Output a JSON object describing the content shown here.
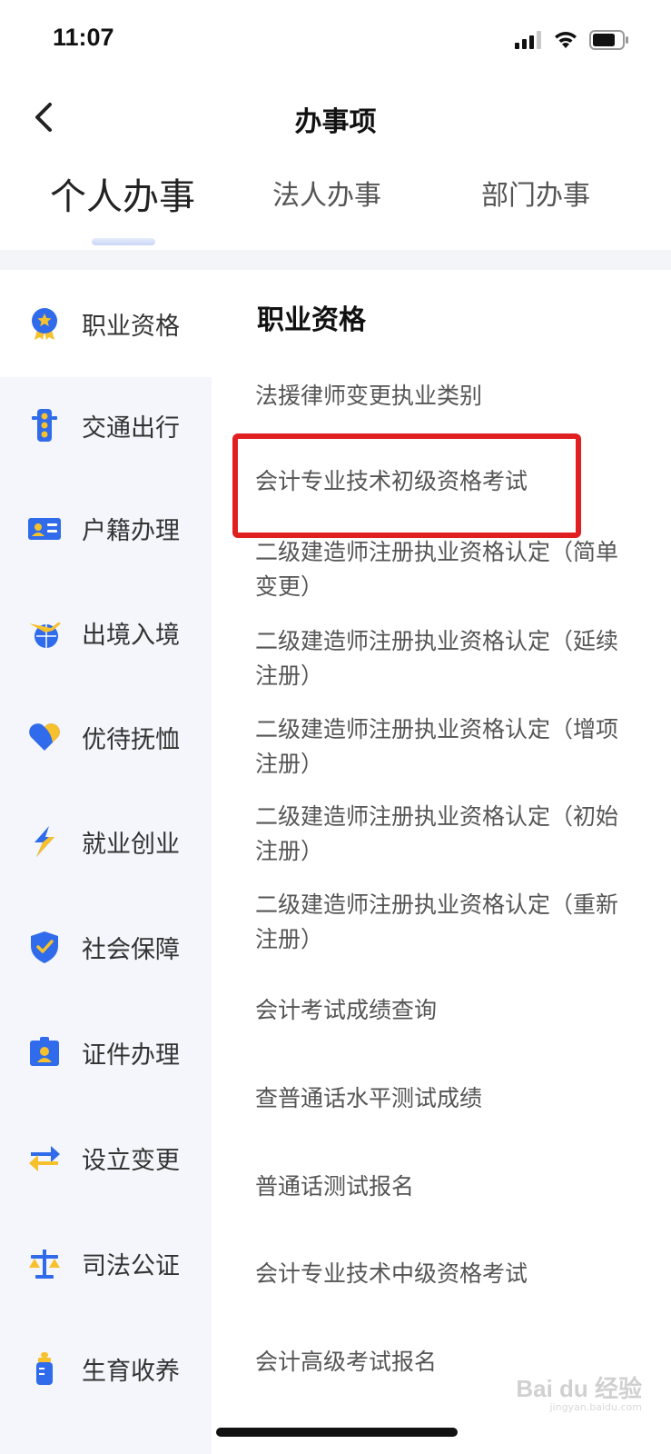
{
  "status_bar": {
    "time": "11:07",
    "icons": [
      "cellular-signal-icon",
      "wifi-icon",
      "battery-icon"
    ]
  },
  "nav": {
    "back_icon": "chevron-left-icon",
    "title": "办事项"
  },
  "tabs": [
    {
      "label": "个人办事",
      "active": true
    },
    {
      "label": "法人办事",
      "active": false
    },
    {
      "label": "部门办事",
      "active": false
    }
  ],
  "sidebar": {
    "items": [
      {
        "label": "职业资格",
        "icon": "medal-icon",
        "active": true
      },
      {
        "label": "交通出行",
        "icon": "traffic-light-icon",
        "active": false
      },
      {
        "label": "户籍办理",
        "icon": "id-card-icon",
        "active": false
      },
      {
        "label": "出境入境",
        "icon": "airplane-globe-icon",
        "active": false
      },
      {
        "label": "优待抚恤",
        "icon": "heart-icon",
        "active": false
      },
      {
        "label": "就业创业",
        "icon": "lightning-icon",
        "active": false
      },
      {
        "label": "社会保障",
        "icon": "shield-check-icon",
        "active": false
      },
      {
        "label": "证件办理",
        "icon": "certificate-icon",
        "active": false
      },
      {
        "label": "设立变更",
        "icon": "swap-arrows-icon",
        "active": false
      },
      {
        "label": "司法公证",
        "icon": "scales-icon",
        "active": false
      },
      {
        "label": "生育收养",
        "icon": "baby-bottle-icon",
        "active": false
      }
    ]
  },
  "content": {
    "section_title": "职业资格",
    "items": [
      "法援律师变更执业类别",
      "会计专业技术初级资格考试",
      "二级建造师注册执业资格认定（简单变更）",
      "二级建造师注册执业资格认定（延续注册）",
      "二级建造师注册执业资格认定（增项注册）",
      "二级建造师注册执业资格认定（初始注册）",
      "二级建造师注册执业资格认定（重新注册）",
      "会计考试成绩查询",
      "查普通话水平测试成绩",
      "普通话测试报名",
      "会计专业技术中级资格考试",
      "会计高级考试报名"
    ]
  },
  "watermark": {
    "text": "Bai du 经验",
    "sub": "jingyan.baidu.com"
  },
  "colors": {
    "accent_blue": "#2f6bea",
    "accent_yellow": "#f6c12c",
    "highlight_red": "#e02020",
    "sidebar_bg": "#f4f6fb"
  }
}
